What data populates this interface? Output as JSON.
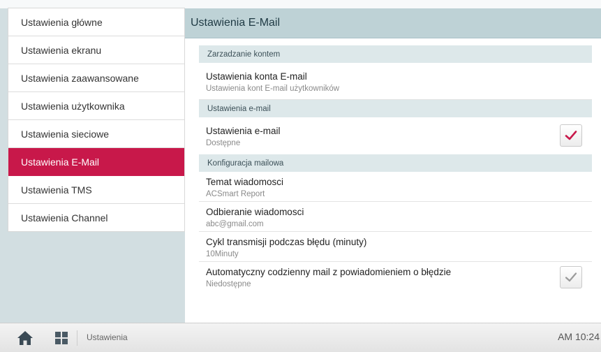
{
  "sidebar": {
    "items": [
      {
        "label": "Ustawienia główne"
      },
      {
        "label": "Ustawienia ekranu"
      },
      {
        "label": "Ustawienia zaawansowane"
      },
      {
        "label": "Ustawienia użytkownika"
      },
      {
        "label": "Ustawienia sieciowe"
      },
      {
        "label": "Ustawienia E-Mail",
        "active": true
      },
      {
        "label": "Ustawienia TMS"
      },
      {
        "label": "Ustawienia Channel"
      }
    ]
  },
  "main": {
    "title": "Ustawienia E-Mail",
    "sections": [
      {
        "header": "Zarzadzanie kontem",
        "items": [
          {
            "title": "Ustawienia konta E-mail",
            "subtitle": "Ustawienia kont E-mail użytkowników"
          }
        ]
      },
      {
        "header": "Ustawienia e-mail",
        "items": [
          {
            "title": "Ustawienia e-mail",
            "subtitle": "Dostępne",
            "checkbox": "checked"
          }
        ]
      },
      {
        "header": "Konfiguracja mailowa",
        "items": [
          {
            "title": "Temat wiadomosci",
            "subtitle": "ACSmart Report"
          },
          {
            "title": "Odbieranie wiadomosci",
            "subtitle": "abc@gmail.com"
          },
          {
            "title": "Cykl transmisji podczas błędu (minuty)",
            "subtitle": "10Minuty"
          },
          {
            "title": "Automatyczny codzienny mail z powiadomieniem o błędzie",
            "subtitle": "Niedostępne",
            "checkbox": "unchecked"
          }
        ]
      }
    ]
  },
  "bottombar": {
    "home_icon": "home-icon",
    "grid_icon": "grid-icon",
    "label": "Ustawienia",
    "time": "AM 10:24"
  },
  "colors": {
    "accent": "#c8184a",
    "header_bg": "#bed2d6",
    "section_bg": "#dde8ea",
    "background": "#d2dee1",
    "check_active": "#c8184a",
    "check_inactive": "#9a9a9a"
  }
}
